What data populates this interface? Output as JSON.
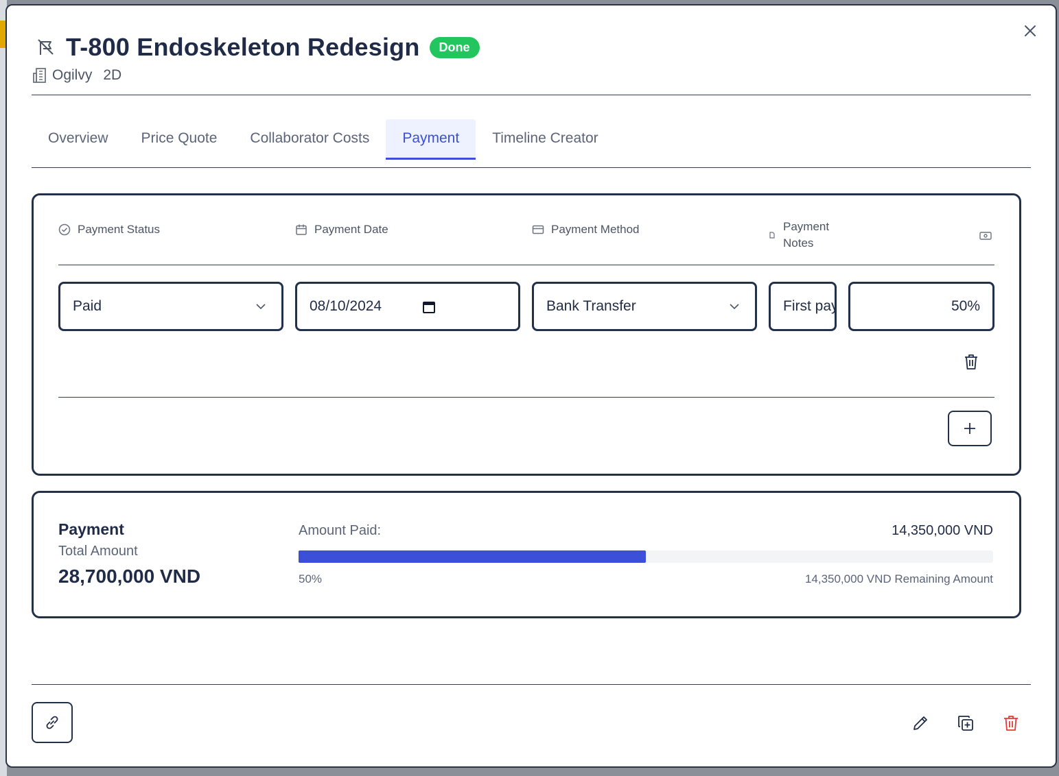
{
  "header": {
    "title": "T-800 Endoskeleton Redesign",
    "status_badge": "Done",
    "client": "Ogilvy",
    "type": "2D",
    "colors": {
      "badge": "#22c55e",
      "accent": "#3b4fd8",
      "danger": "#e53935"
    }
  },
  "tabs": [
    {
      "label": "Overview",
      "active": false
    },
    {
      "label": "Price Quote",
      "active": false
    },
    {
      "label": "Collaborator Costs",
      "active": false
    },
    {
      "label": "Payment",
      "active": true
    },
    {
      "label": "Timeline Creator",
      "active": false
    }
  ],
  "payment_table": {
    "columns": {
      "status": "Payment Status",
      "date": "Payment Date",
      "method": "Payment Method",
      "notes": "Payment Notes"
    },
    "row": {
      "status": "Paid",
      "date": "08/10/2024",
      "method": "Bank Transfer",
      "notes": "First payment",
      "percent": "50%"
    }
  },
  "summary": {
    "title": "Payment",
    "total_label": "Total Amount",
    "total_value": "28,700,000 VND",
    "paid_label": "Amount Paid:",
    "paid_value": "14,350,000 VND",
    "progress_fraction": 0.5,
    "progress_label": "50%",
    "remaining": "14,350,000 VND Remaining Amount"
  },
  "icons": [
    "close-icon",
    "flag-off-icon",
    "building-icon",
    "check-circle-icon",
    "calendar-icon",
    "credit-card-icon",
    "note-icon",
    "money-icon",
    "chevron-down-icon",
    "trash-icon",
    "plus-icon",
    "link-icon",
    "pencil-icon",
    "duplicate-icon"
  ]
}
